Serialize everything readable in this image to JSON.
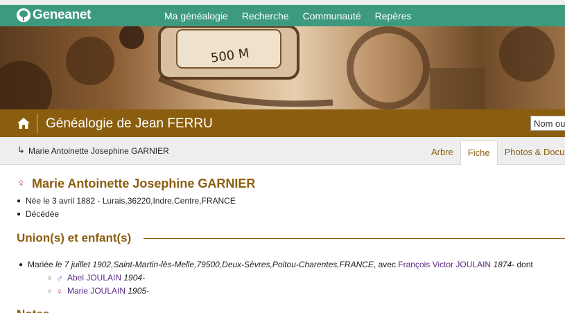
{
  "nav": {
    "logo": "Geneanet",
    "links": [
      "Ma généalogie",
      "Recherche",
      "Communauté",
      "Repères"
    ]
  },
  "banner": {
    "odometer": "500 M"
  },
  "titlebar": {
    "title": "Généalogie de Jean FERRU",
    "search_placeholder": "Nom ou"
  },
  "breadcrumb": {
    "arrow": "↳",
    "person": "Marie Antoinette Josephine GARNIER"
  },
  "tabs": [
    "Arbre",
    "Fiche",
    "Photos & Documents"
  ],
  "active_tab": "Fiche",
  "person": {
    "gender_symbol": "♀",
    "name": "Marie Antoinette Josephine GARNIER",
    "birth": "Née le 3 avril 1882 - Lurais,36220,Indre,Centre,FRANCE",
    "death": "Décédée"
  },
  "unions": {
    "heading": "Union(s) et enfant(s)",
    "marriage": {
      "prefix": "Mariée",
      "date": "le 7 juillet 1902",
      "sep": " , ",
      "place": "Saint-Martin-lès-Melle,79500,Deux-Sèvres,Poitou-Charentes,FRANCE",
      "avec": ", avec",
      "spouse": "François Victor JOULAIN",
      "spouse_years": "1874-",
      "dont": "dont"
    },
    "children": [
      {
        "symbol": "♂",
        "name": "Abel JOULAIN",
        "years": "1904-"
      },
      {
        "symbol": "♀",
        "name": "Marie JOULAIN",
        "years": "1905-"
      }
    ]
  },
  "notes_heading_peek": "Notes",
  "colors": {
    "nav_green": "#3d9a7f",
    "brown": "#8b5e0f",
    "female": "#d4468c",
    "male": "#1b5aa8",
    "link_purple": "#5b2a86"
  }
}
